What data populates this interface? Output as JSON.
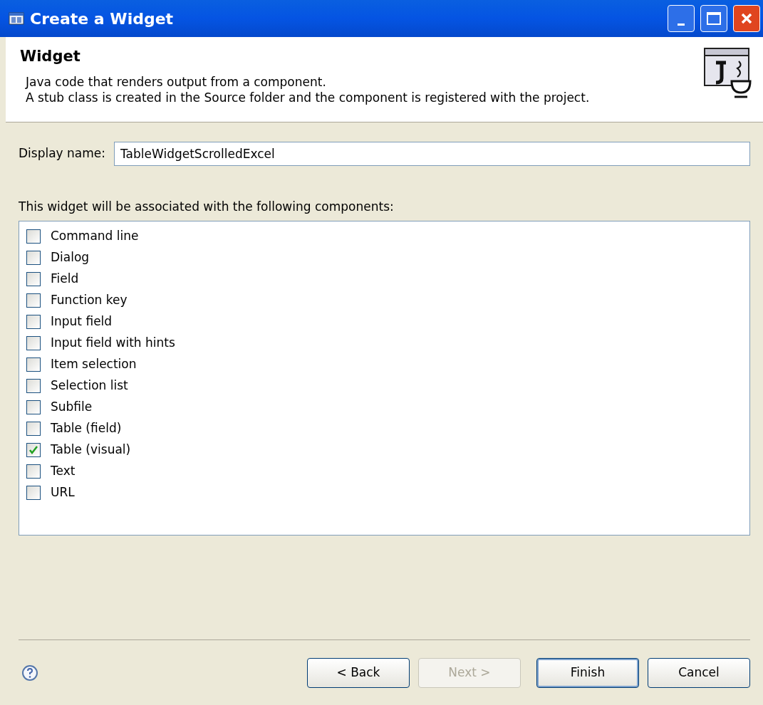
{
  "window": {
    "title": "Create a Widget"
  },
  "header": {
    "title": "Widget",
    "description": [
      "Java code that renders output from a component.",
      "A stub class is created in the Source folder and the component is registered with the project."
    ]
  },
  "display_name": {
    "label": "Display name:",
    "value": "TableWidgetScrolledExcel"
  },
  "components": {
    "label": "This widget will be associated with the following components:",
    "items": [
      {
        "label": "Command line",
        "checked": false
      },
      {
        "label": "Dialog",
        "checked": false
      },
      {
        "label": "Field",
        "checked": false
      },
      {
        "label": "Function key",
        "checked": false
      },
      {
        "label": "Input field",
        "checked": false
      },
      {
        "label": "Input field with hints",
        "checked": false
      },
      {
        "label": "Item selection",
        "checked": false
      },
      {
        "label": "Selection list",
        "checked": false
      },
      {
        "label": "Subfile",
        "checked": false
      },
      {
        "label": "Table (field)",
        "checked": false
      },
      {
        "label": "Table (visual)",
        "checked": true
      },
      {
        "label": "Text",
        "checked": false
      },
      {
        "label": "URL",
        "checked": false
      }
    ]
  },
  "buttons": [
    {
      "label": "< Back",
      "disabled": false,
      "default": false
    },
    {
      "label": "Next >",
      "disabled": true,
      "default": false
    },
    {
      "label": "Finish",
      "disabled": false,
      "default": true
    },
    {
      "label": "Cancel",
      "disabled": false,
      "default": false
    }
  ]
}
